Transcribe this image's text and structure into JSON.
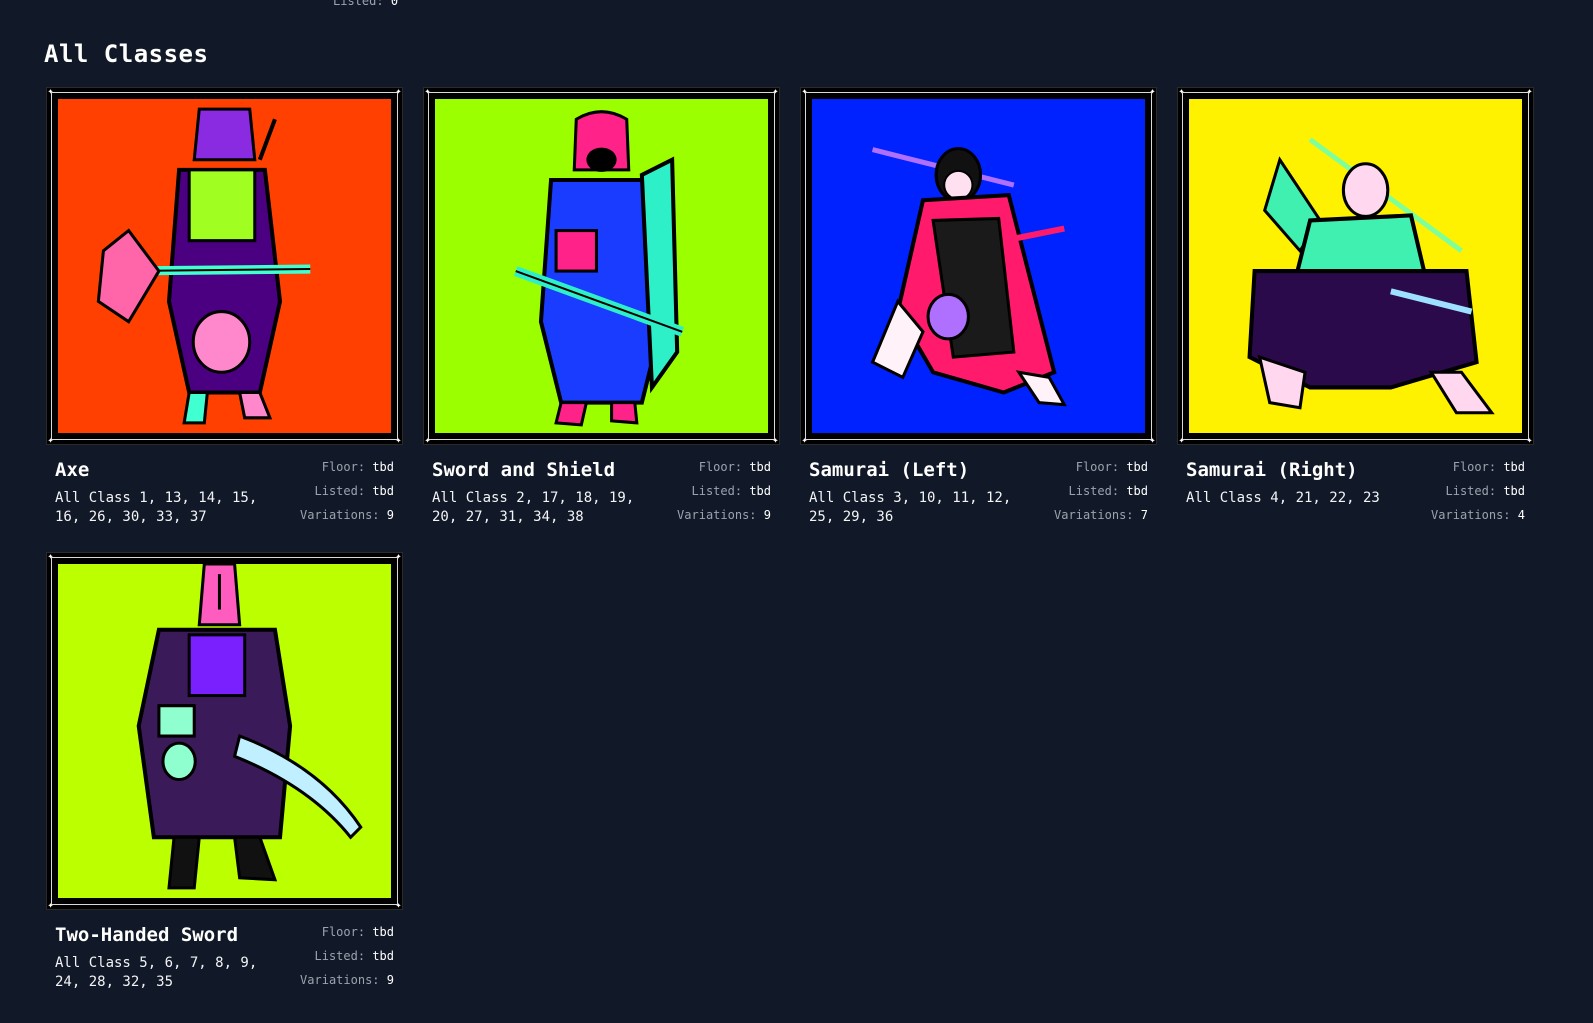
{
  "top": {
    "listed_label": "Listed:",
    "listed_value": "0"
  },
  "section": {
    "title": "All Classes"
  },
  "labels": {
    "floor": "Floor:",
    "listed": "Listed:",
    "variations": "Variations:"
  },
  "classes": [
    {
      "name": "Axe",
      "description": "All Class 1, 13, 14, 15, 16, 26, 30, 33, 37",
      "floor": "tbd",
      "listed": "tbd",
      "variations": "9",
      "bg_color": "#ff4000",
      "icon": "axe-warrior-art"
    },
    {
      "name": "Sword and Shield",
      "description": "All Class 2, 17, 18, 19, 20, 27, 31, 34, 38",
      "floor": "tbd",
      "listed": "tbd",
      "variations": "9",
      "bg_color": "#9cff00",
      "icon": "sword-shield-warrior-art"
    },
    {
      "name": "Samurai (Left)",
      "description": "All Class 3, 10, 11, 12, 25, 29, 36",
      "floor": "tbd",
      "listed": "tbd",
      "variations": "7",
      "bg_color": "#0022ff",
      "icon": "samurai-left-art"
    },
    {
      "name": "Samurai (Right)",
      "description": "All Class 4, 21, 22, 23",
      "floor": "tbd",
      "listed": "tbd",
      "variations": "4",
      "bg_color": "#fff200",
      "icon": "samurai-right-art"
    },
    {
      "name": "Two-Handed Sword",
      "description": "All Class 5, 6, 7, 8, 9, 24, 28, 32, 35",
      "floor": "tbd",
      "listed": "tbd",
      "variations": "9",
      "bg_color": "#bbff00",
      "icon": "two-handed-sword-warrior-art"
    }
  ]
}
